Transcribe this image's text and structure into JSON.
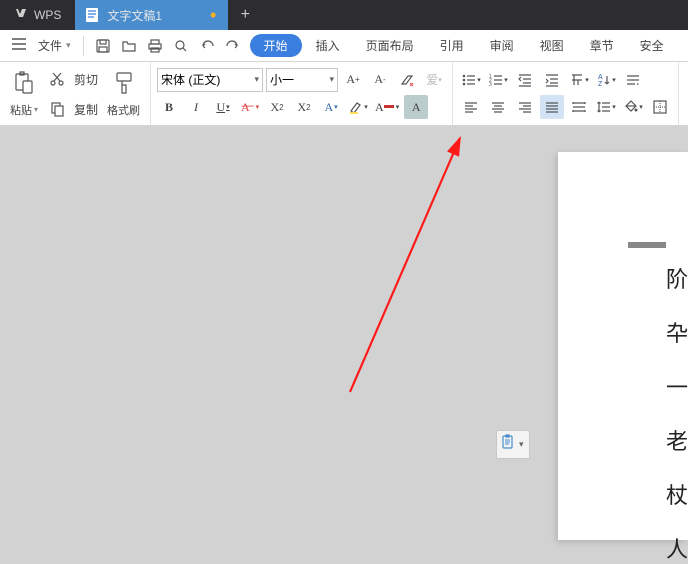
{
  "titlebar": {
    "app_name": "WPS",
    "doc_title": "文字文稿1",
    "modified_indicator": "•",
    "new_tab": "+"
  },
  "menubar": {
    "file_label": "文件",
    "items": [
      "开始",
      "插入",
      "页面布局",
      "引用",
      "审阅",
      "视图",
      "章节",
      "安全"
    ]
  },
  "ribbon": {
    "clipboard": {
      "cut_label": "剪切",
      "copy_label": "复制",
      "paste_label": "粘贴",
      "format_painter_label": "格式刷"
    },
    "font": {
      "font_name": "宋体 (正文)",
      "font_size": "小一"
    }
  },
  "page": {
    "chars": [
      "阶",
      "卆",
      "一",
      "老",
      "杖",
      "人"
    ]
  }
}
